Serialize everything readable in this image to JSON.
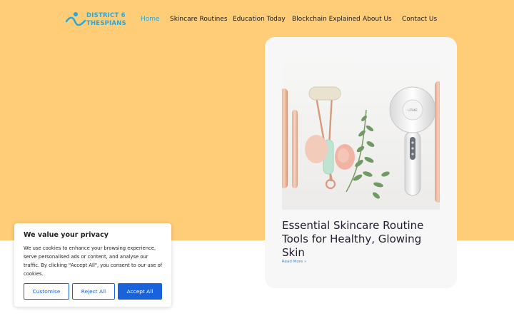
{
  "brand": {
    "line1": "DISTRICT 6",
    "line2": "THESPIANS",
    "logo_icon": "performer-wave-logo",
    "color": "#2aa9d6"
  },
  "nav": {
    "items": [
      {
        "label": "Home",
        "active": true
      },
      {
        "label": "Skincare Routines",
        "active": false
      },
      {
        "label": "Education Today",
        "active": false
      },
      {
        "label": "Blockchain Explained",
        "active": false
      },
      {
        "label": "About Us",
        "active": false
      },
      {
        "label": "Contact Us",
        "active": false
      }
    ]
  },
  "colors": {
    "hero": "#ffcd78",
    "card": "#f7f7f7",
    "accent": "#1863dc"
  },
  "post": {
    "title": "Essential Skincare Routine Tools for Healthy, Glowing Skin",
    "read_more": "Read More »",
    "image_alt": "facial roller, gua sha stones, eucalyptus sprig and cleansing device",
    "device_brand": "LITAKE"
  },
  "cookie": {
    "title": "We value your privacy",
    "text": "We use cookies to enhance your browsing experience, serve personalised ads or content, and analyse our traffic. By clicking \"Accept All\", you consent to our use of cookies.",
    "customise": "Customise",
    "reject": "Reject All",
    "accept": "Accept All"
  }
}
